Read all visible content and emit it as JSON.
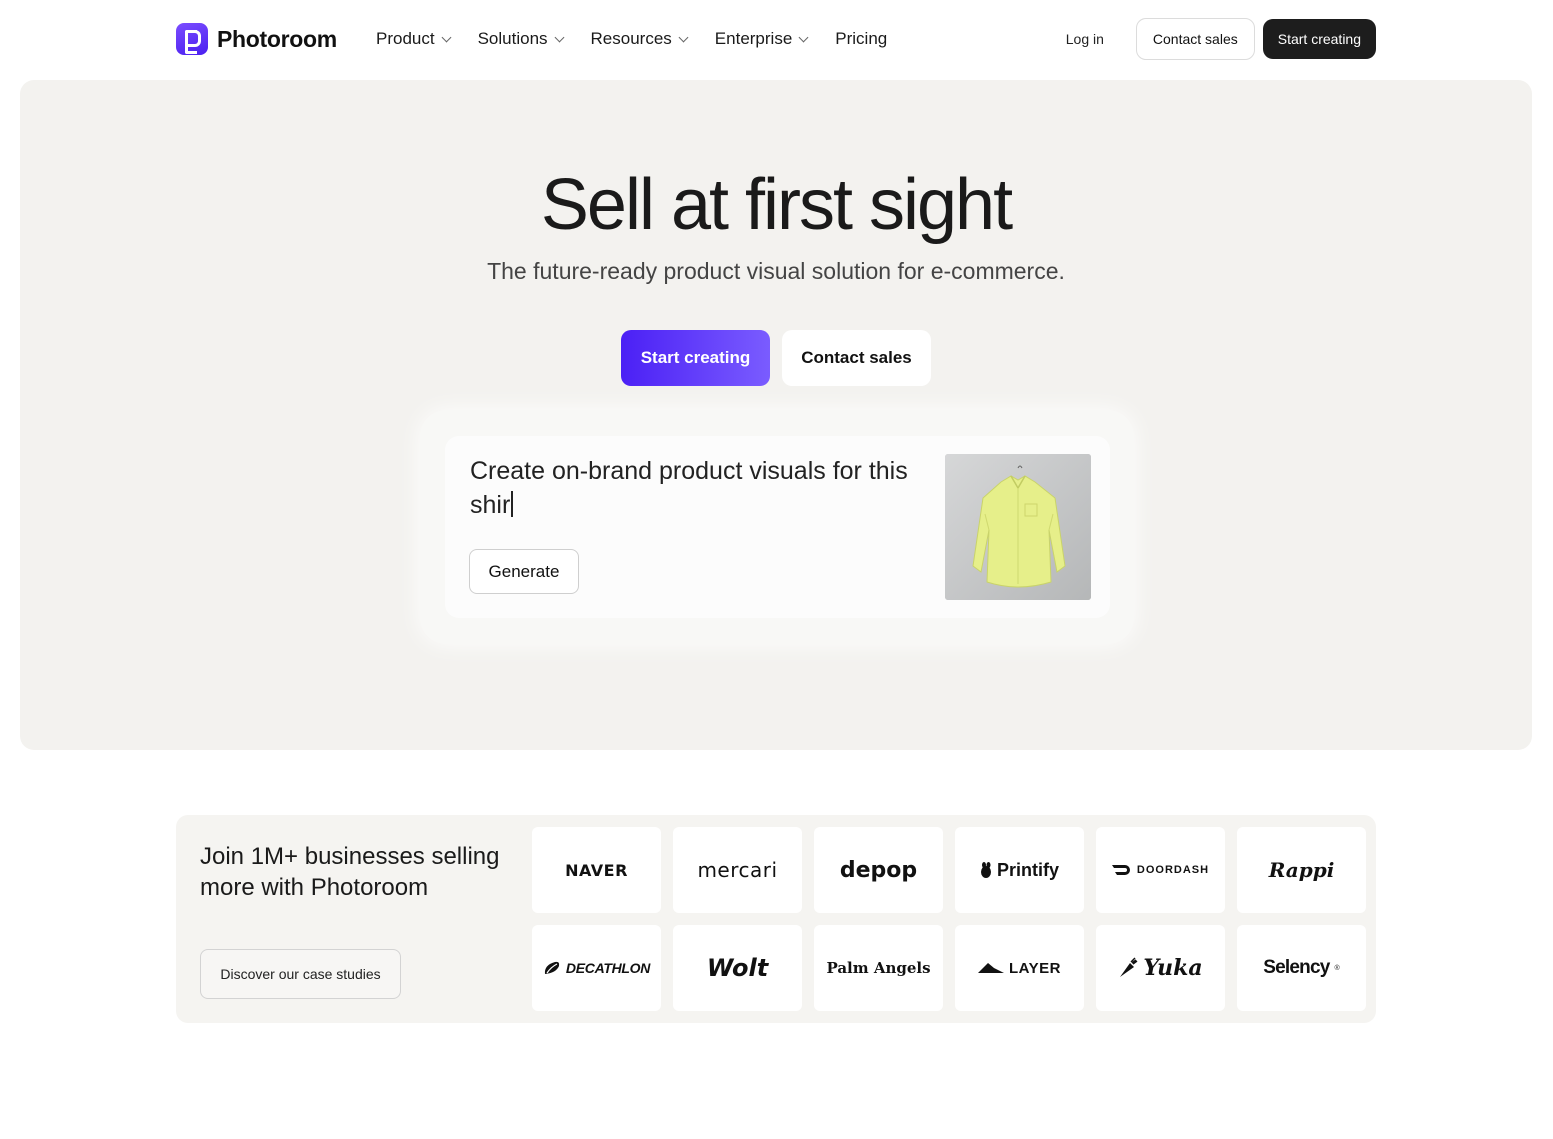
{
  "nav": {
    "brand": "Photoroom",
    "menu": [
      {
        "label": "Product",
        "has_dropdown": true
      },
      {
        "label": "Solutions",
        "has_dropdown": true
      },
      {
        "label": "Resources",
        "has_dropdown": true
      },
      {
        "label": "Enterprise",
        "has_dropdown": true
      },
      {
        "label": "Pricing",
        "has_dropdown": false
      }
    ],
    "login": "Log in",
    "contact_sales": "Contact sales",
    "start_creating": "Start creating"
  },
  "hero": {
    "title": "Sell at first sight",
    "subtitle": "The future-ready product visual solution for e-commerce.",
    "cta_primary": "Start creating",
    "cta_secondary": "Contact sales",
    "prompt": {
      "text": "Create on-brand product visuals for this shir",
      "generate": "Generate",
      "thumbnail": "yellow-shirt-image"
    }
  },
  "brands": {
    "title": "Join 1M+ businesses selling more with Photoroom",
    "case_studies": "Discover our case studies",
    "logos": [
      "NAVER",
      "mercari",
      "depop",
      "Printify",
      "DOORDASH",
      "Rappi",
      "DECATHLON",
      "Wolt",
      "Palm Angels",
      "LAYER",
      "Yuka",
      "Selency"
    ]
  },
  "colors": {
    "accent_start": "#4b20f5",
    "accent_end": "#7a5cff",
    "hero_bg": "#f3f2ef",
    "dark_button": "#1d1d1d"
  }
}
